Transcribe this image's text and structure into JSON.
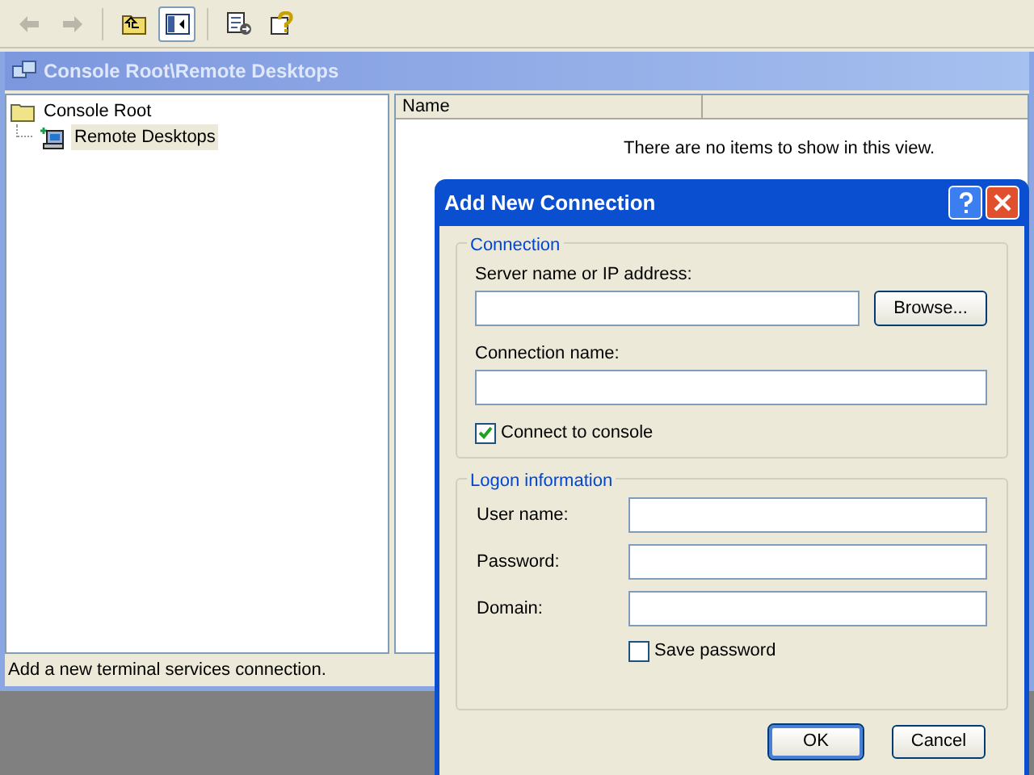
{
  "toolbar": [
    {
      "kind": "back",
      "disabled": true
    },
    {
      "kind": "forward",
      "disabled": true
    },
    {
      "kind": "up",
      "disabled": false,
      "pressed": false
    },
    {
      "kind": "tree",
      "disabled": false,
      "pressed": true
    },
    {
      "kind": "export",
      "disabled": false,
      "pressed": false
    },
    {
      "kind": "help",
      "disabled": false,
      "pressed": false
    }
  ],
  "window": {
    "title": "Console Root\\Remote Desktops"
  },
  "tree": [
    {
      "label": "Console Root",
      "selected": false,
      "children": [
        {
          "label": "Remote Desktops",
          "selected": true
        }
      ]
    }
  ],
  "list": {
    "columns": [
      "Name"
    ],
    "empty_message": "There are no items to show in this view."
  },
  "status_bar": "Add a new terminal services connection.",
  "dialog": {
    "title": "Add New Connection",
    "connection": {
      "legend": "Connection",
      "server_label": "Server name or IP address:",
      "browse_button": "Browse...",
      "name_label": "Connection name:",
      "console_checkbox": {
        "label": "Connect to console",
        "checked": true
      }
    },
    "logon": {
      "legend": "Logon information",
      "fields": [
        {
          "label": "User name:"
        },
        {
          "label": "Password:"
        },
        {
          "label": "Domain:"
        }
      ],
      "save_checkbox": {
        "label": "Save password",
        "checked": false
      }
    },
    "buttons": [
      {
        "label": "OK",
        "default": true
      },
      {
        "label": "Cancel",
        "default": false
      }
    ]
  }
}
